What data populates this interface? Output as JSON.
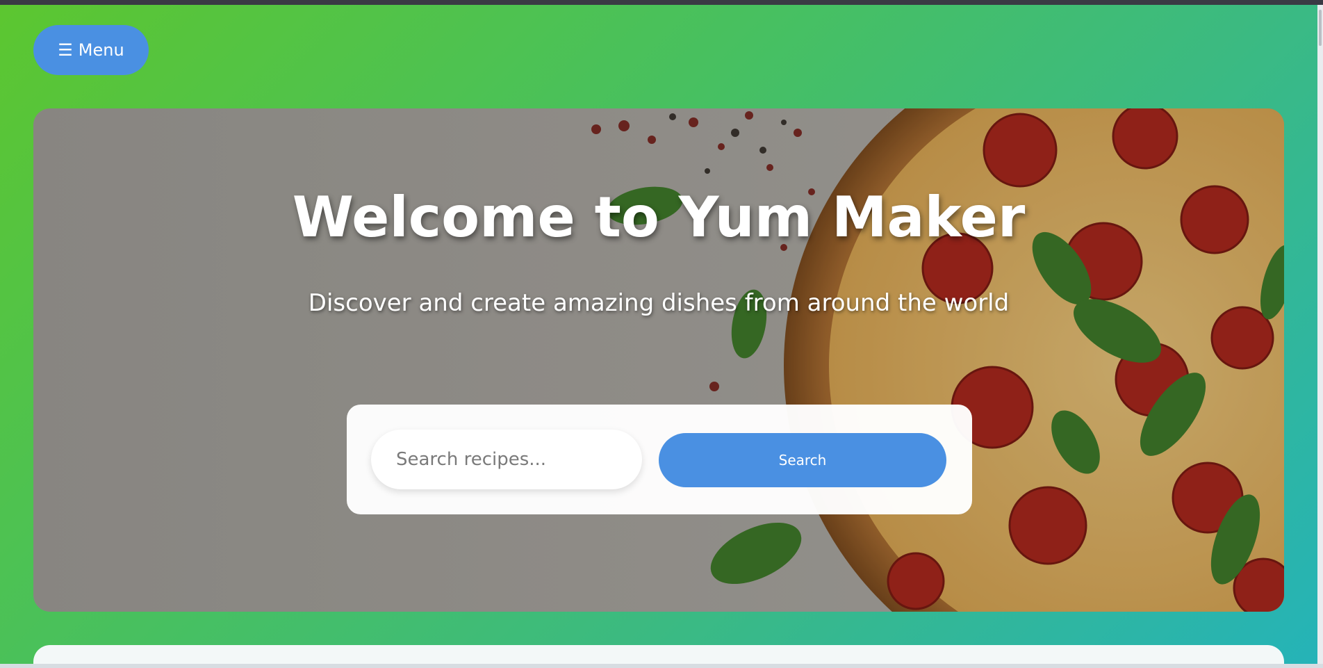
{
  "nav": {
    "menu_icon": "☰",
    "menu_label": "Menu"
  },
  "hero": {
    "title": "Welcome to Yum Maker",
    "subtitle": "Discover and create amazing dishes from around the world",
    "background_image": "pizza-with-basil-and-peppercorns"
  },
  "search": {
    "placeholder": "Search recipes...",
    "button_label": "Search"
  },
  "colors": {
    "accent": "#4a90e2",
    "gradient_start": "#5cc630",
    "gradient_end": "#25b3b8"
  }
}
